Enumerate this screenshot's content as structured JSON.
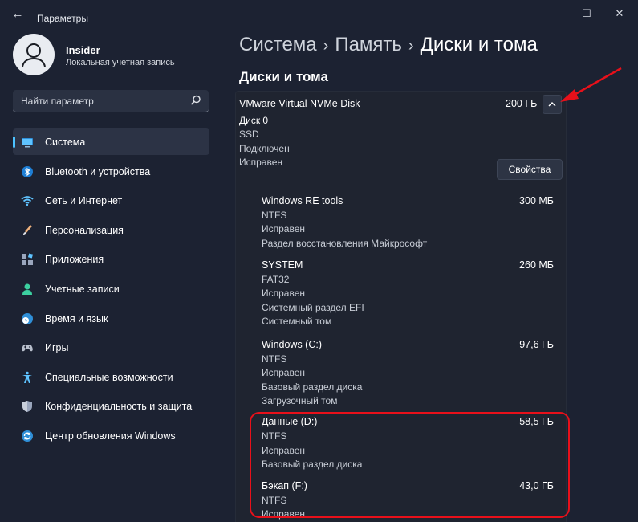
{
  "window": {
    "title": "Параметры",
    "back_glyph": "←",
    "minimize_glyph": "—",
    "maximize_glyph": "☐",
    "close_glyph": "✕"
  },
  "profile": {
    "name": "Insider",
    "account_type": "Локальная учетная запись"
  },
  "search": {
    "placeholder": "Найти параметр"
  },
  "sidebar": {
    "items": [
      {
        "label": "Система",
        "icon": "display-icon",
        "active": true
      },
      {
        "label": "Bluetooth и устройства",
        "icon": "bluetooth-icon"
      },
      {
        "label": "Сеть и Интернет",
        "icon": "wifi-icon"
      },
      {
        "label": "Персонализация",
        "icon": "brush-icon"
      },
      {
        "label": "Приложения",
        "icon": "apps-icon"
      },
      {
        "label": "Учетные записи",
        "icon": "person-icon"
      },
      {
        "label": "Время и язык",
        "icon": "globe-clock-icon"
      },
      {
        "label": "Игры",
        "icon": "gamepad-icon"
      },
      {
        "label": "Специальные возможности",
        "icon": "accessibility-icon"
      },
      {
        "label": "Конфиденциальность и защита",
        "icon": "shield-icon"
      },
      {
        "label": "Центр обновления Windows",
        "icon": "update-icon"
      }
    ]
  },
  "breadcrumb": {
    "part1": "Система",
    "part2": "Память",
    "part3": "Диски и тома",
    "separator": "›"
  },
  "section": {
    "title": "Диски и тома"
  },
  "disk": {
    "name": "VMware Virtual NVMe Disk",
    "size": "200 ГБ",
    "details": [
      "Диск 0",
      "SSD",
      "Подключен",
      "Исправен"
    ],
    "properties_label": "Свойства"
  },
  "volumes": [
    {
      "name": "Windows RE tools",
      "size": "300 МБ",
      "details": [
        "NTFS",
        "Исправен",
        "Раздел восстановления Майкрософт"
      ]
    },
    {
      "name": "SYSTEM",
      "size": "260 МБ",
      "details": [
        "FAT32",
        "Исправен",
        "Системный раздел EFI",
        "Системный том"
      ]
    },
    {
      "name": "Windows (C:)",
      "size": "97,6 ГБ",
      "details": [
        "NTFS",
        "Исправен",
        "Базовый раздел диска",
        "Загрузочный том"
      ]
    },
    {
      "name": "Данные (D:)",
      "size": "58,5 ГБ",
      "details": [
        "NTFS",
        "Исправен",
        "Базовый раздел диска"
      ]
    },
    {
      "name": "Бэкап (F:)",
      "size": "43,0 ГБ",
      "details": [
        "NTFS",
        "Исправен"
      ]
    }
  ],
  "colors": {
    "background": "#1c2232",
    "accent": "#4cc2ff",
    "highlight": "#e8101a"
  }
}
